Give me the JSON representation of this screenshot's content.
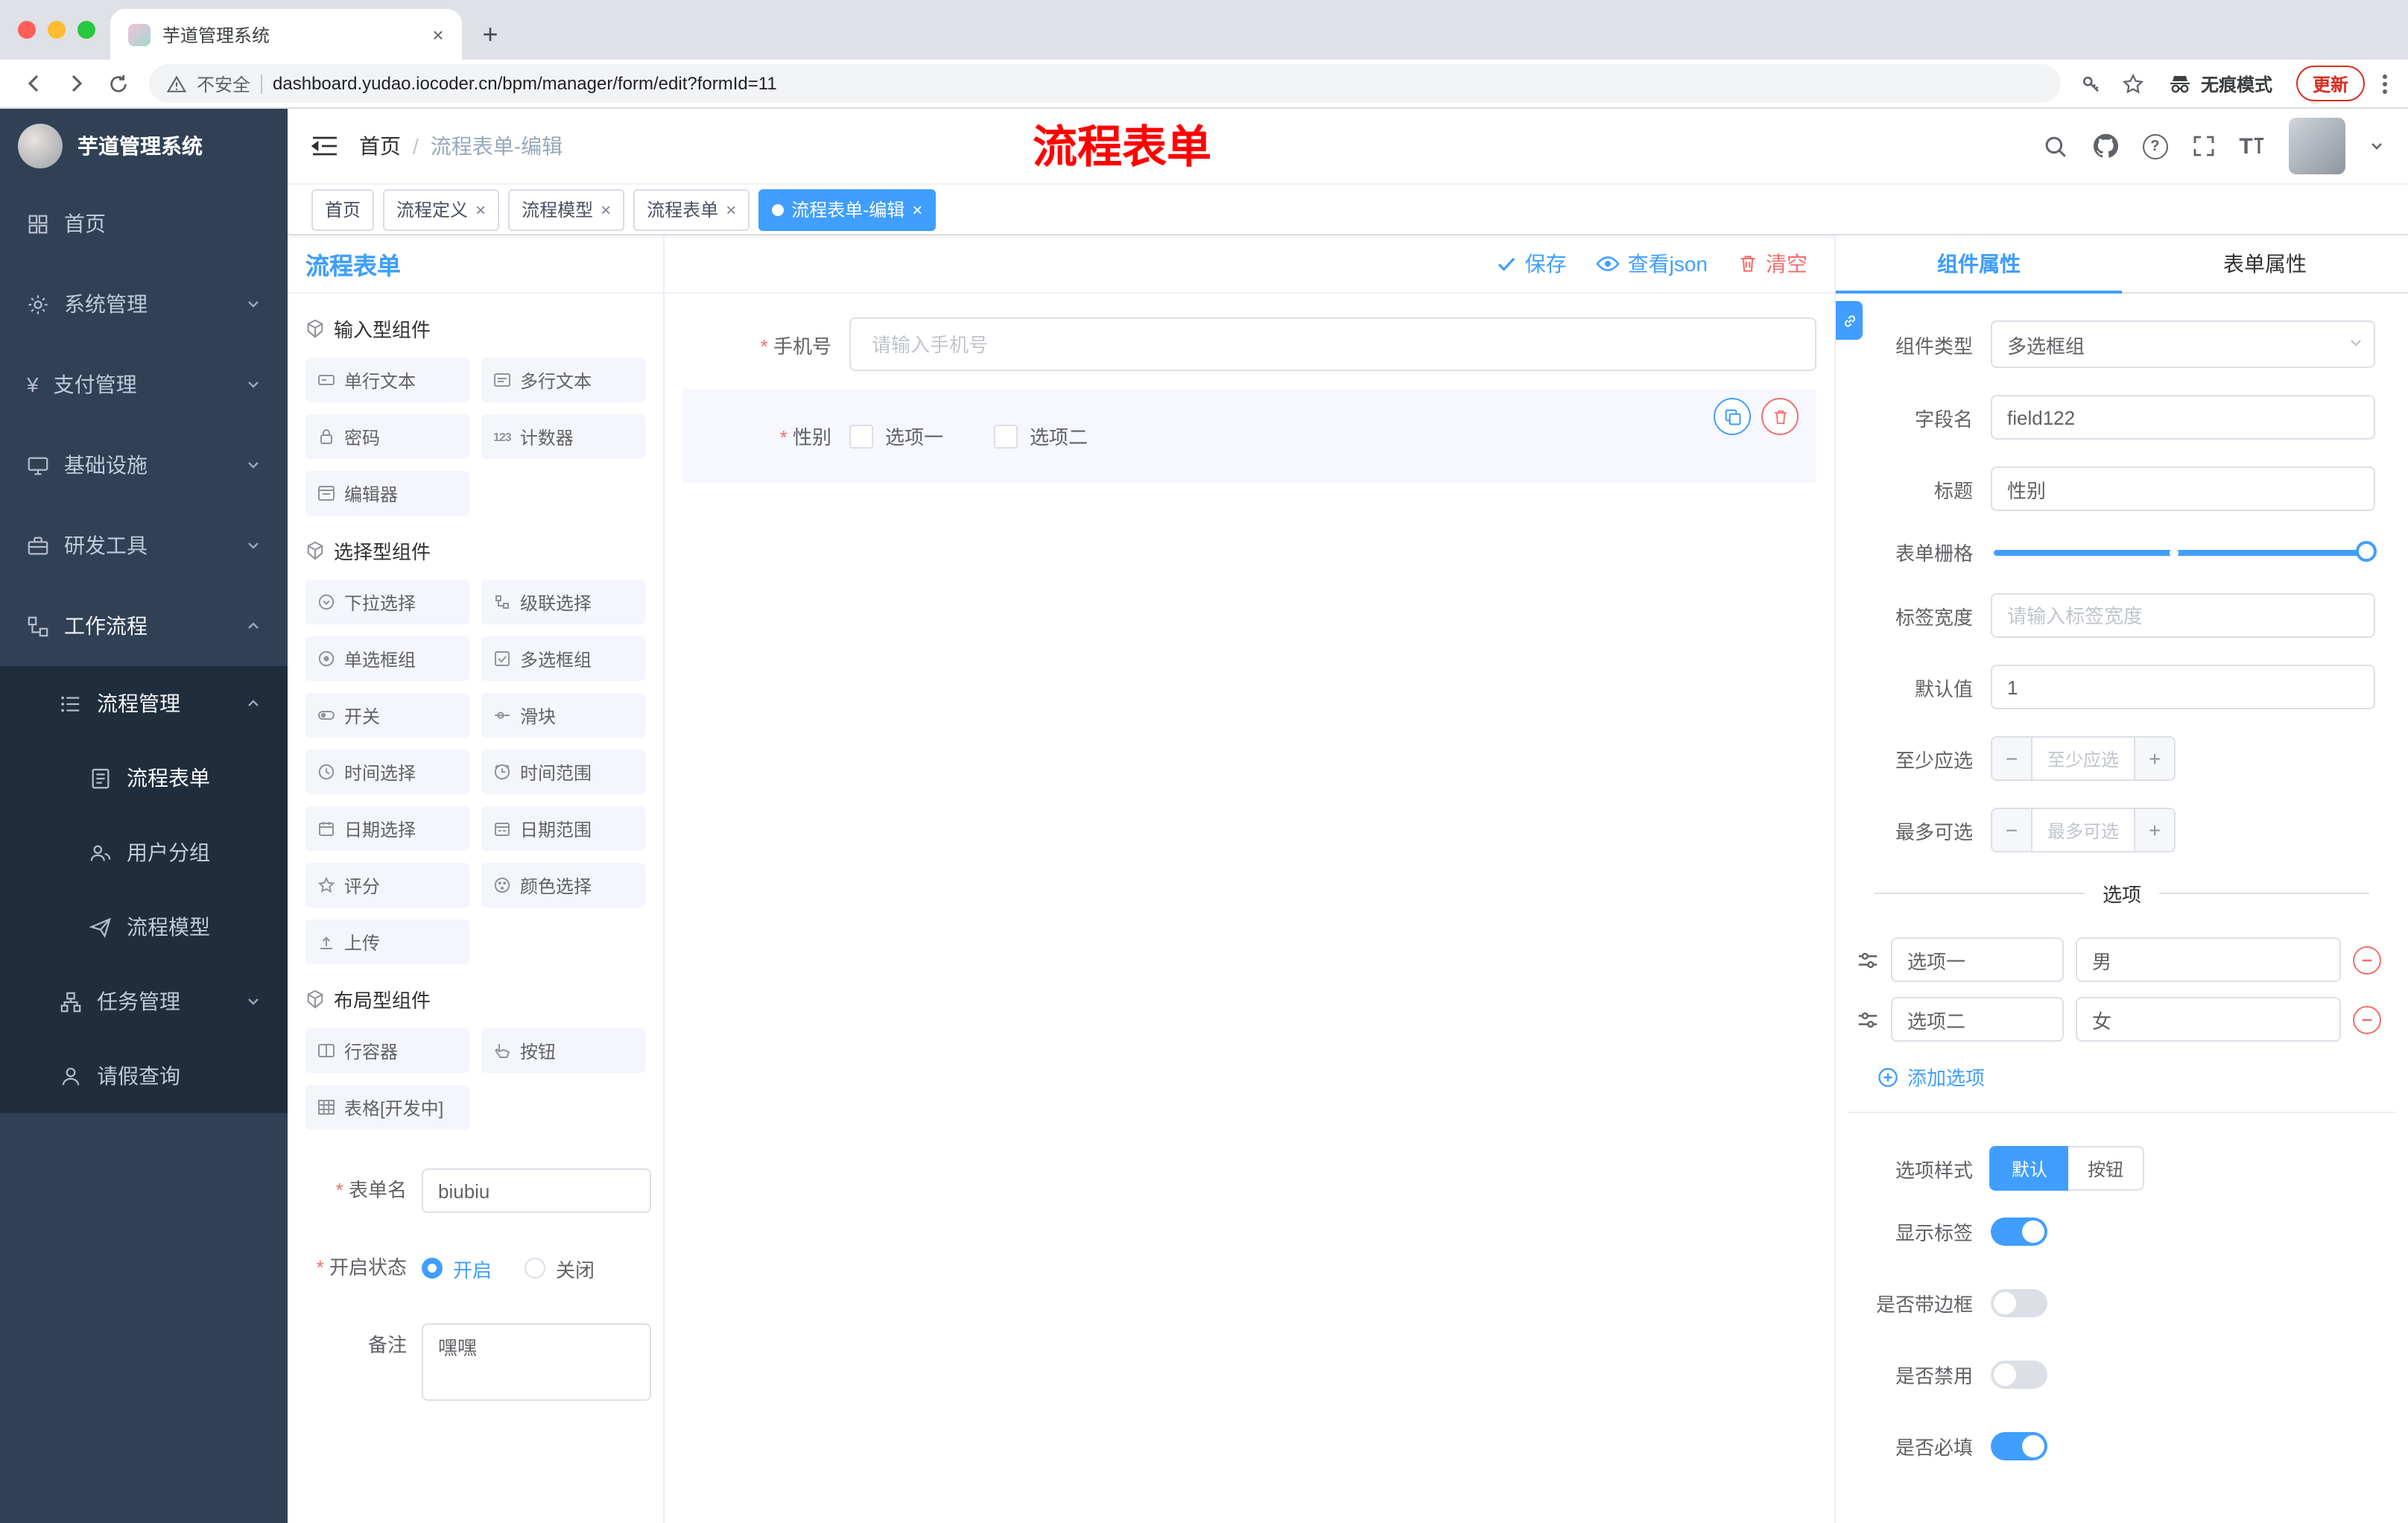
{
  "colors": {
    "accent": "#409EFF",
    "danger": "#F56C6C",
    "sidebar_bg": "#304156",
    "submenu_bg": "#1F2D3D",
    "annotation": "#FF0000"
  },
  "browser": {
    "tab_title": "芋道管理系统",
    "security_label": "不安全",
    "url": "dashboard.yudao.iocoder.cn/bpm/manager/form/edit?formId=11",
    "incognito_label": "无痕模式",
    "update_label": "更新"
  },
  "sidebar": {
    "app_title": "芋道管理系统",
    "items": [
      {
        "label": "首页"
      },
      {
        "label": "系统管理"
      },
      {
        "label": "支付管理"
      },
      {
        "label": "基础设施"
      },
      {
        "label": "研发工具"
      },
      {
        "label": "工作流程"
      },
      {
        "label": "流程管理"
      },
      {
        "label": "流程表单"
      },
      {
        "label": "用户分组"
      },
      {
        "label": "流程模型"
      },
      {
        "label": "任务管理"
      },
      {
        "label": "请假查询"
      }
    ]
  },
  "header": {
    "breadcrumb": [
      "首页",
      "流程表单-编辑"
    ],
    "annotation": "流程表单"
  },
  "tags": [
    {
      "label": "首页"
    },
    {
      "label": "流程定义"
    },
    {
      "label": "流程模型"
    },
    {
      "label": "流程表单"
    },
    {
      "label": "流程表单-编辑"
    }
  ],
  "palette": {
    "title": "流程表单",
    "groups": [
      {
        "title": "输入型组件",
        "items": [
          "单行文本",
          "多行文本",
          "密码",
          "计数器",
          "编辑器"
        ]
      },
      {
        "title": "选择型组件",
        "items": [
          "下拉选择",
          "级联选择",
          "单选框组",
          "多选框组",
          "开关",
          "滑块",
          "时间选择",
          "时间范围",
          "日期选择",
          "日期范围",
          "评分",
          "颜色选择",
          "上传"
        ]
      },
      {
        "title": "布局型组件",
        "items": [
          "行容器",
          "按钮",
          "表格[开发中]"
        ]
      }
    ],
    "form": {
      "name_label": "表单名",
      "name_value": "biubiu",
      "status_label": "开启状态",
      "status_on": "开启",
      "status_off": "关闭",
      "remark_label": "备注",
      "remark_value": "嘿嘿"
    }
  },
  "canvas": {
    "actions": {
      "save": "保存",
      "view_json": "查看json",
      "clear": "清空"
    },
    "phone": {
      "label": "手机号",
      "placeholder": "请输入手机号"
    },
    "gender": {
      "label": "性别",
      "options": [
        "选项一",
        "选项二"
      ]
    }
  },
  "properties": {
    "tabs": [
      "组件属性",
      "表单属性"
    ],
    "component_type_label": "组件类型",
    "component_type_value": "多选框组",
    "field_name_label": "字段名",
    "field_name_value": "field122",
    "title_label": "标题",
    "title_value": "性别",
    "grid_label": "表单栅格",
    "label_width_label": "标签宽度",
    "label_width_placeholder": "请输入标签宽度",
    "default_label": "默认值",
    "default_value": "1",
    "min_label": "至少应选",
    "min_placeholder": "至少应选",
    "max_label": "最多可选",
    "max_placeholder": "最多可选",
    "options_section": {
      "title": "选项",
      "rows": [
        {
          "label": "选项一",
          "value": "男"
        },
        {
          "label": "选项二",
          "value": "女"
        }
      ],
      "add_label": "添加选项"
    },
    "style": {
      "label": "选项样式",
      "options": [
        "默认",
        "按钮"
      ],
      "selected": "默认"
    },
    "toggles": [
      {
        "label": "显示标签",
        "on": true
      },
      {
        "label": "是否带边框",
        "on": false
      },
      {
        "label": "是否禁用",
        "on": false
      },
      {
        "label": "是否必填",
        "on": true
      }
    ]
  }
}
